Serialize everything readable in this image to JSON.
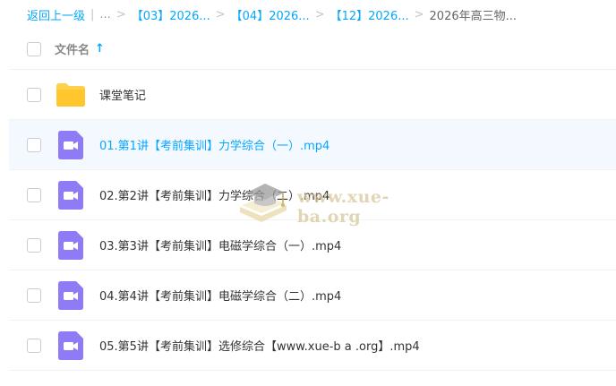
{
  "breadcrumb": {
    "back_label": "返回上一级",
    "separator": "|",
    "ellipsis": "...",
    "chevron": ">",
    "items": [
      "【03】2026...",
      "【04】2026...",
      "【12】2026..."
    ],
    "current": "2026年高三物..."
  },
  "header": {
    "column_label": "文件名",
    "sort_arrow": "↑"
  },
  "files": [
    {
      "name": "课堂笔记",
      "icon": "folder-icon"
    },
    {
      "name": "01.第1讲【考前集训】力学综合（一）.mp4",
      "icon": "video-file-icon"
    },
    {
      "name": "02.第2讲【考前集训】力学综合（二）.mp4",
      "icon": "video-file-icon"
    },
    {
      "name": "03.第3讲【考前集训】电磁学综合（一）.mp4",
      "icon": "video-file-icon"
    },
    {
      "name": "04.第4讲【考前集训】电磁学综合（二）.mp4",
      "icon": "video-file-icon"
    },
    {
      "name": "05.第5讲【考前集训】选修综合【www.xue-b a .org】.mp4",
      "icon": "video-file-icon"
    }
  ],
  "watermark": {
    "text": "www.xue-ba.org",
    "icon": "graduation-cap-logo"
  },
  "colors": {
    "accent": "#06a7ff",
    "folder": "#ffd04b",
    "video_icon": "#8f7bf5",
    "hover_row": "#f3f9ff"
  }
}
